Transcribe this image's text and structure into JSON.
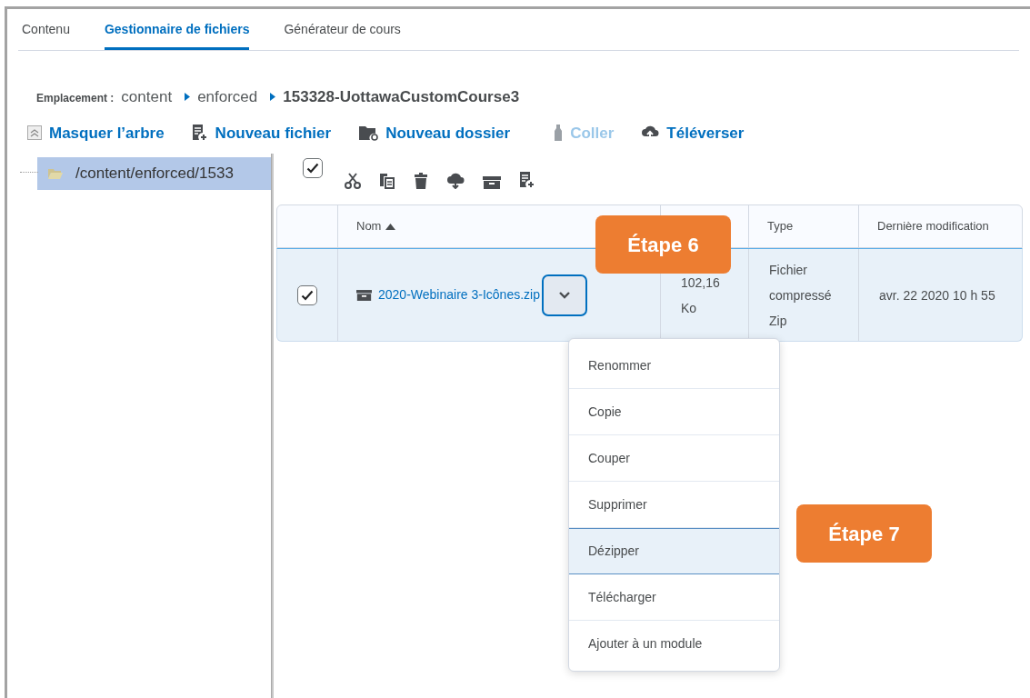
{
  "tabs": [
    {
      "label": "Contenu",
      "selected": false
    },
    {
      "label": "Gestionnaire de fichiers",
      "selected": true
    },
    {
      "label": "Générateur de cours",
      "selected": false
    }
  ],
  "location": {
    "label": "Emplacement :",
    "items": [
      {
        "label": "content",
        "current": false
      },
      {
        "label": "enforced",
        "current": false
      },
      {
        "label": "153328-UottawaCustomCourse3",
        "current": true
      }
    ]
  },
  "actions": [
    {
      "kind": "collapse",
      "label": "Masquer l’arbre",
      "disabled": false
    },
    {
      "kind": "new-file",
      "label": "Nouveau fichier",
      "disabled": false
    },
    {
      "kind": "new-folder",
      "label": "Nouveau dossier",
      "disabled": false
    },
    {
      "kind": "paste",
      "label": "Coller",
      "disabled": true
    },
    {
      "kind": "upload",
      "label": "Téléverser",
      "disabled": false
    }
  ],
  "tree": [
    {
      "label": "/content/enforced/1533",
      "selected": true
    }
  ],
  "toolbar": {
    "select_all_checked": true
  },
  "table": {
    "headers": {
      "name": "Nom",
      "type": "Type",
      "modified": "Dernière modification"
    },
    "rows": [
      {
        "selected": true,
        "checked": true,
        "name": "2020-Webinaire 3-Icônes.zip",
        "size": "102,16 Ko",
        "type": "Fichier compressé Zip",
        "modified": "avr. 22 2020 10 h 55"
      }
    ]
  },
  "menu": {
    "items": [
      {
        "label": "Renommer",
        "selected": false
      },
      {
        "label": "Copie",
        "selected": false
      },
      {
        "label": "Couper",
        "selected": false
      },
      {
        "label": "Supprimer",
        "selected": false
      },
      {
        "label": "Dézipper",
        "selected": true
      },
      {
        "label": "Télécharger",
        "selected": false
      },
      {
        "label": "Ajouter à un module",
        "selected": false
      }
    ]
  },
  "callouts": [
    {
      "label": "Étape 6"
    },
    {
      "label": "Étape 7"
    }
  ]
}
